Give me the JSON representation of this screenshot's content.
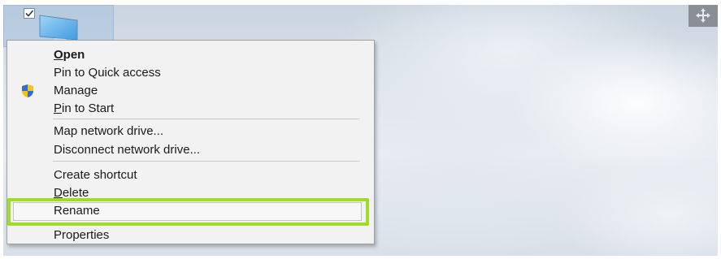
{
  "context_menu": {
    "items": [
      {
        "label": "Open",
        "bold": true,
        "highlighted": false
      },
      {
        "label": "Pin to Quick access",
        "bold": false,
        "highlighted": false
      },
      {
        "label": "Manage",
        "bold": false,
        "icon": "uac-shield-icon",
        "highlighted": false
      },
      {
        "label": "Pin to Start",
        "bold": false,
        "highlighted": false
      },
      {
        "label": "Map network drive...",
        "bold": false,
        "highlighted": false
      },
      {
        "label": "Disconnect network drive...",
        "bold": false,
        "highlighted": false
      },
      {
        "label": "Create shortcut",
        "bold": false,
        "highlighted": false
      },
      {
        "label": "Delete",
        "bold": false,
        "highlighted": false
      },
      {
        "label": "Rename",
        "bold": false,
        "highlighted": true
      },
      {
        "label": "Properties",
        "bold": false,
        "highlighted": false
      }
    ],
    "highlight_color": "#9ddc28"
  },
  "desktop": {
    "selected_icon": "this-pc-monitor-icon",
    "selected_icon_checked": true,
    "corner_control": "move-arrows-icon"
  }
}
